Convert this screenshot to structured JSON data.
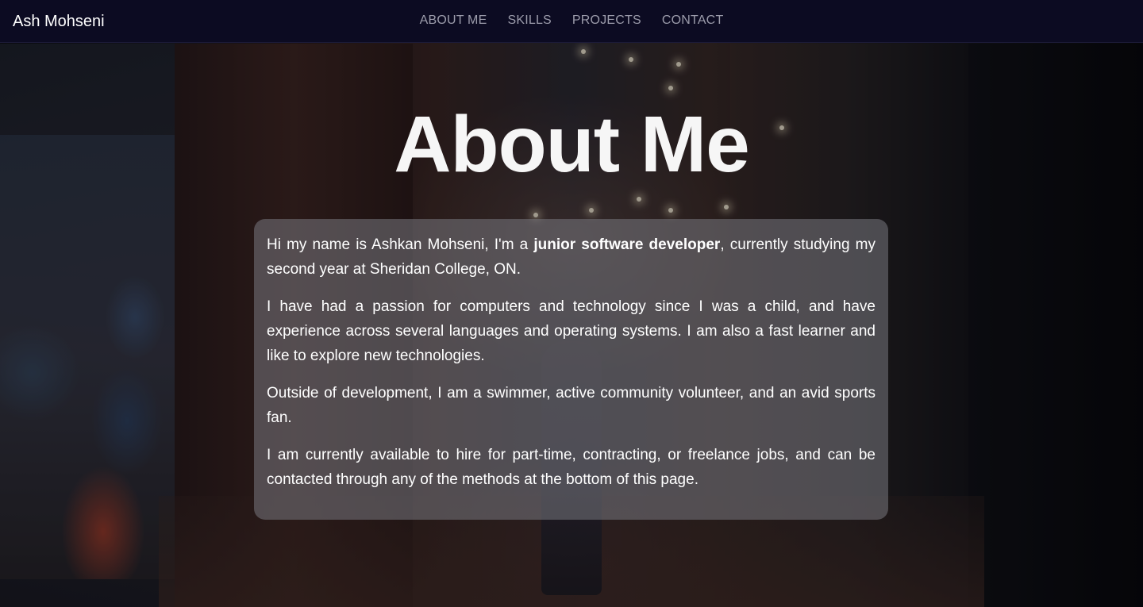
{
  "navbar": {
    "brand": "Ash Mohseni",
    "links": [
      "ABOUT ME",
      "SKILLS",
      "PROJECTS",
      "CONTACT"
    ]
  },
  "about": {
    "title": "About Me",
    "paragraph1": {
      "before": "Hi my name is Ashkan Mohseni, I'm a ",
      "bold": "junior software developer",
      "after": ", currently studying my second year at Sheridan College, ON."
    },
    "paragraph2": "I have had a passion for computers and technology since I was a child, and have experience across several languages and operating systems. I am also a fast learner and like to explore new technologies.",
    "paragraph3": "Outside of development, I am a swimmer, active community volunteer, and an avid sports fan.",
    "paragraph4": "I am currently available to hire for part-time, contracting, or freelance jobs, and can be contacted through any of the methods at the bottom of this page."
  },
  "colors": {
    "navbar_bg": "#0c0b22",
    "nav_link": "#9c9cab",
    "card_bg": "rgba(120,120,128,0.55)",
    "text": "#ffffff"
  }
}
